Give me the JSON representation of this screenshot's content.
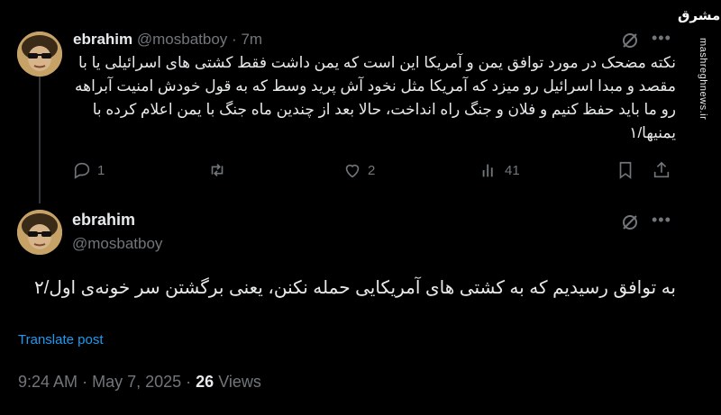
{
  "tweet1": {
    "display_name": "ebrahim",
    "handle": "@mosbatboy",
    "separator": "·",
    "time": "7m",
    "text": "نکته مضحک در مورد توافق یمن و آمریکا این است که یمن داشت فقط کشتی های اسرائیلی یا با مقصد و مبدا اسرائیل رو میزد که آمریکا مثل نخود آش پرید وسط که به قول خودش امنیت آبراهه رو ما باید حفظ کنیم و فلان و جنگ راه انداخت، حالا بعد از چندین ماه جنگ با یمن اعلام کرده با یمنیها/۱",
    "replies": "1",
    "reposts": "",
    "likes": "2",
    "views": "41"
  },
  "tweet2": {
    "display_name": "ebrahim",
    "handle": "@mosbatboy",
    "text": "به توافق رسیدیم که به کشتی های آمریکایی حمله نکنن، یعنی برگشتن سر خونه‌ی اول/۲",
    "translate_label": "Translate post",
    "time": "9:24 AM",
    "date": "May 7, 2025",
    "views_count": "26",
    "views_label": "Views",
    "separator": "·"
  },
  "watermark": {
    "site": "mashreghnews.ir",
    "logo": "مشرق"
  },
  "icons": {
    "grok": "grok-icon",
    "more": "more-icon",
    "reply": "reply-icon",
    "repost": "repost-icon",
    "like": "like-icon",
    "views": "views-icon",
    "bookmark": "bookmark-icon",
    "share": "share-icon"
  },
  "colors": {
    "background": "#000000",
    "text": "#e7e9ea",
    "muted": "#71767b",
    "link": "#1d9bf0"
  }
}
